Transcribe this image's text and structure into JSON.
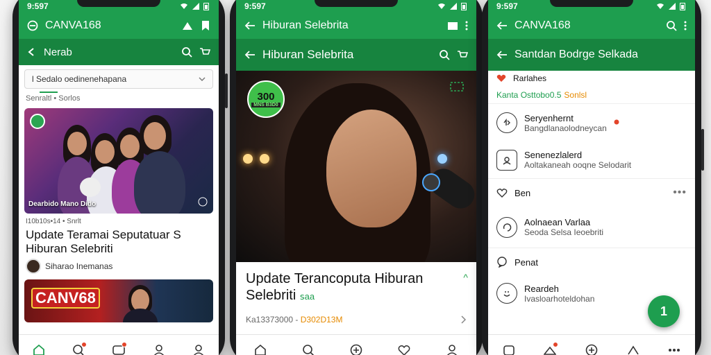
{
  "colors": {
    "brand": "#1e9e4f",
    "accent": "#e68a00",
    "badge": "#e3452b"
  },
  "phone1": {
    "status_time": "9:597",
    "app_title": "CANVA168",
    "sub_title": "Nerab",
    "search_value": "l Sedalo oedinenehapana",
    "crumb": "Senraltl • Sorlos",
    "hero_caption": "Dearbido Mano Dido",
    "meta": "I10b10s•14 • Snrlt",
    "headline": "Update Teramai Seputatuar S Hiburan Selebriti",
    "author": "Siharao Inemanas",
    "card2_logo": "CANV68",
    "nav": [
      "home-icon",
      "chat-icon",
      "inbox-icon",
      "profile-icon",
      "account-icon"
    ]
  },
  "phone2": {
    "status_time": "9:597",
    "app_title": "Hiburan Selebrita",
    "sticker_top": "300",
    "sticker_bottom": "MNS B3D0",
    "headline": "Update Terancoputa Hiburan Selebriti",
    "headline_tag": "ꜱaa",
    "meta_left": "Ka13373000 -",
    "meta_right": "D302D13M",
    "nav": [
      "home-icon",
      "search-icon",
      "add-icon",
      "heart-icon",
      "profile-icon"
    ]
  },
  "phone3": {
    "status_time": "9:597",
    "app_title": "CANVA168",
    "sub_title": "Santdan Bodrge Selkada",
    "top_item": "Rarlahes",
    "tag_line": "Kanta Osttobo0.5",
    "tag_highlight": "Sonlsl",
    "rows": [
      {
        "l1": "Seryenhernt",
        "l2": "Bangdlanaolodneycan"
      },
      {
        "l1": "Senenezlalerd",
        "l2": "Aoltakaneah ooqne Selodarit"
      },
      {
        "l1": "Ben",
        "l2": ""
      },
      {
        "l1": "Aolnaean Varlaa",
        "l2": "Seoda Selsa Ieoebriti"
      },
      {
        "l1": "Penat",
        "l2": ""
      },
      {
        "l1": "Reardeh",
        "l2": "Ivasloarhoteldohan"
      }
    ],
    "fab_label": "1",
    "nav": [
      "home-icon",
      "chat-icon",
      "add-icon",
      "pin-icon",
      "more-icon"
    ]
  }
}
